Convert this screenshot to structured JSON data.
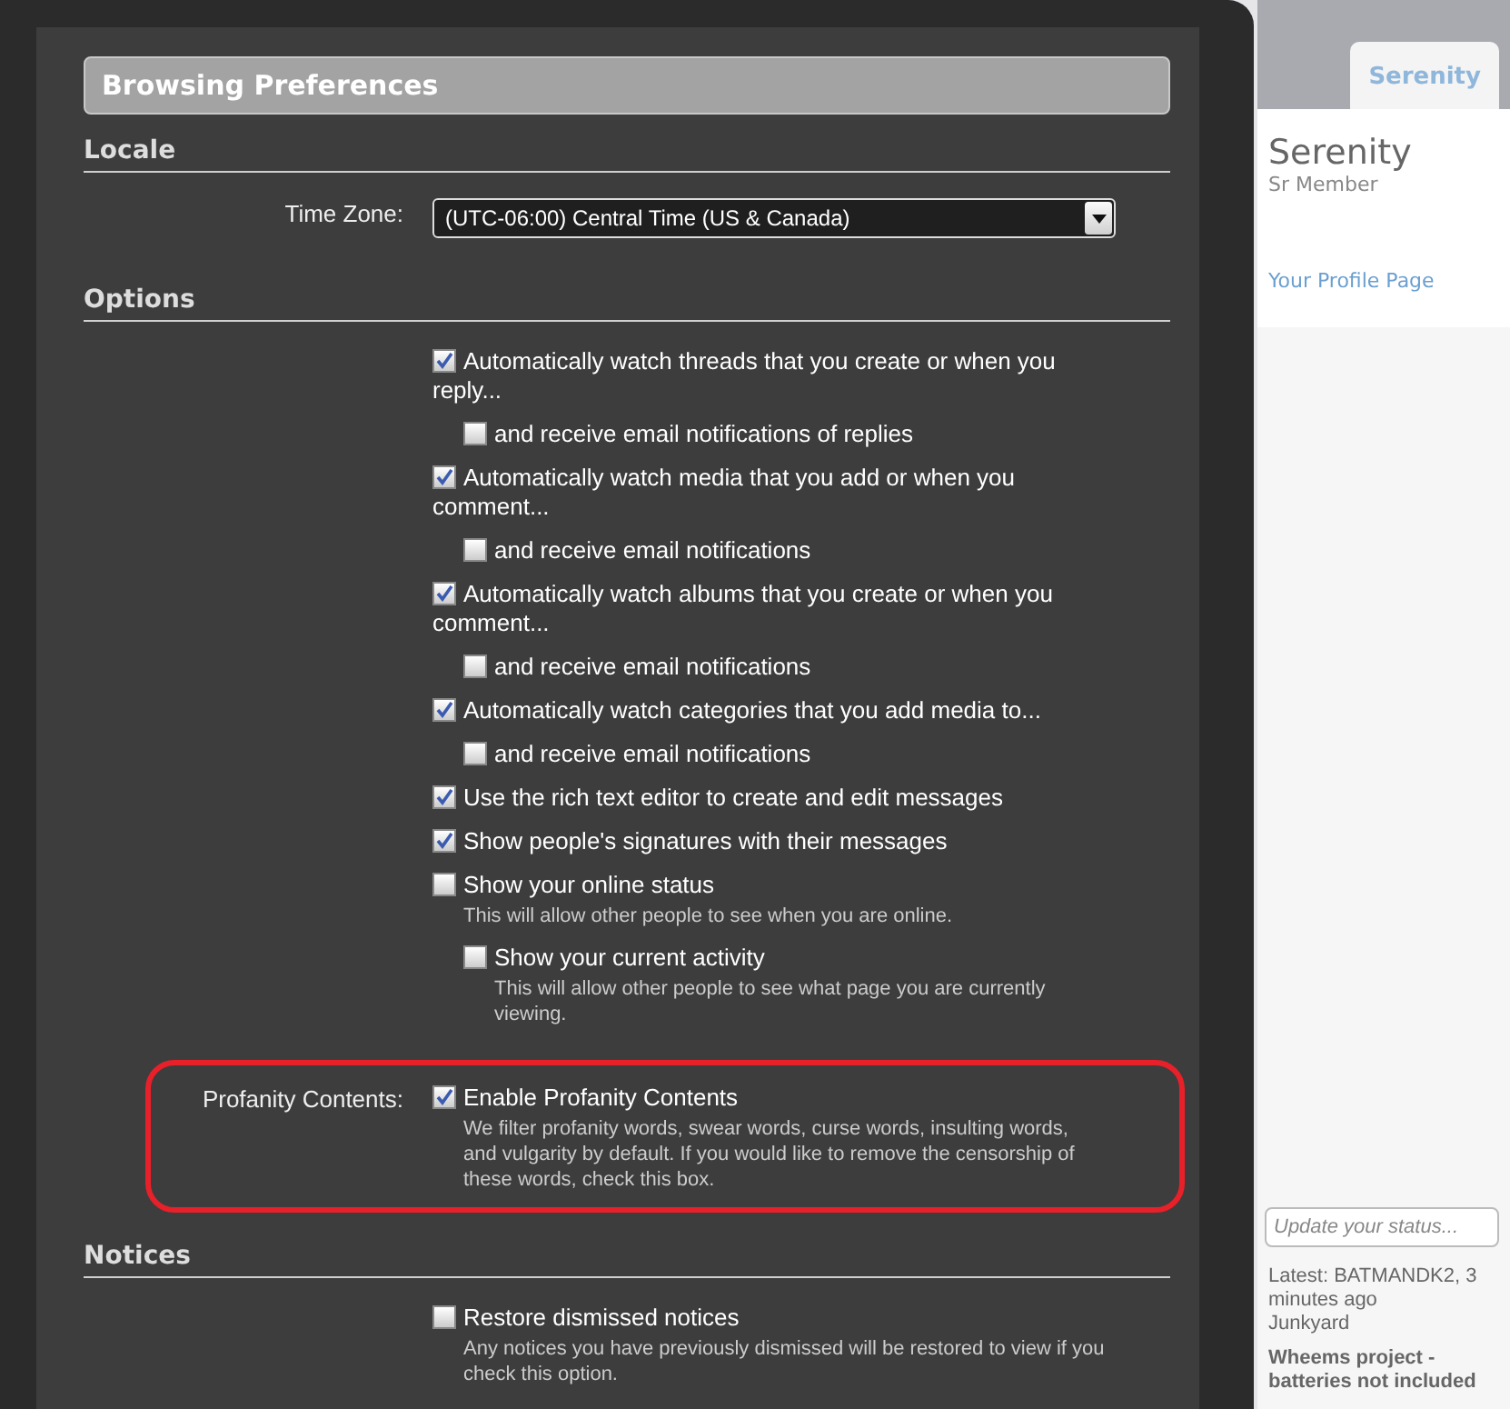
{
  "page": {
    "profile_tab": "Serenity",
    "profile": {
      "name": "Serenity",
      "rank": "Sr Member",
      "link": "Your Profile Page"
    },
    "status_field": {
      "placeholder": "Update your status..."
    },
    "recent_posts": [
      {
        "byline": "Latest: BATMANDK2, 3 minutes ago",
        "forum": "Junkyard"
      },
      {
        "title": "Wheems project -batteries not included"
      }
    ]
  },
  "dialog": {
    "title": "Browsing Preferences",
    "sections": [
      {
        "heading": "Locale",
        "rows": [
          {
            "kind": "select",
            "label": "Time Zone:",
            "value": "(UTC-06:00) Central Time (US & Canada)"
          }
        ]
      },
      {
        "heading": "Options",
        "rows": [
          {
            "kind": "checks",
            "options": [
              {
                "label": "Automatically watch threads that you create or when you reply...",
                "checked": true,
                "children": [
                  {
                    "label": "and receive email notifications of replies",
                    "checked": false
                  }
                ]
              },
              {
                "label": "Automatically watch media that you add or when you comment...",
                "checked": true,
                "children": [
                  {
                    "label": "and receive email notifications",
                    "checked": false
                  }
                ]
              },
              {
                "label": "Automatically watch albums that you create or when you comment...",
                "checked": true,
                "children": [
                  {
                    "label": "and receive email notifications",
                    "checked": false
                  }
                ]
              },
              {
                "label": "Automatically watch categories that you add media to...",
                "checked": true,
                "children": [
                  {
                    "label": "and receive email notifications",
                    "checked": false
                  }
                ]
              },
              {
                "label": "Use the rich text editor to create and edit messages",
                "checked": true
              },
              {
                "label": "Show people's signatures with their messages",
                "checked": true
              },
              {
                "label": "Show your online status",
                "checked": false,
                "hint": "This will allow other people to see when you are online.",
                "children": [
                  {
                    "label": "Show your current activity",
                    "checked": false,
                    "hint": "This will allow other people to see what page you are currently viewing."
                  }
                ]
              }
            ]
          },
          {
            "kind": "checks",
            "label": "Profanity Contents:",
            "highlighted": true,
            "options": [
              {
                "label": "Enable Profanity Contents",
                "checked": true,
                "hint": "We filter profanity words, swear words, curse words, insulting words, and vulgarity by default. If you would like to remove the censorship of these words, check this box."
              }
            ]
          }
        ]
      },
      {
        "heading": "Notices",
        "rows": [
          {
            "kind": "checks",
            "options": [
              {
                "label": "Restore dismissed notices",
                "checked": false,
                "hint": "Any notices you have previously dismissed will be restored to view if you check this option."
              }
            ]
          }
        ]
      }
    ]
  }
}
